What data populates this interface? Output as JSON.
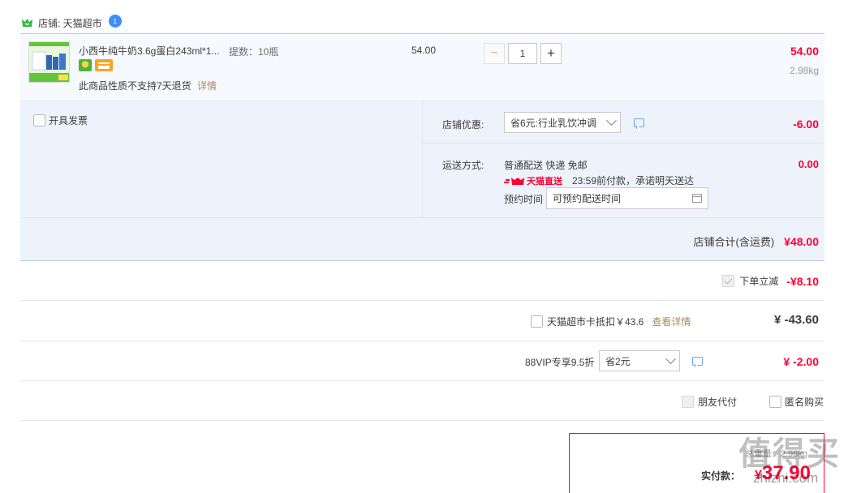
{
  "shop": {
    "label": "店铺: 天猫超市",
    "badge": "1"
  },
  "item": {
    "title": "小西牛纯牛奶3.6g蛋白243ml*1...",
    "spec": "提数：10瓶",
    "unit_price": "54.00",
    "quantity": "1",
    "minus": "−",
    "plus": "+",
    "subtotal": "54.00",
    "weight": "2.98kg",
    "return_note": "此商品性质不支持7天退货",
    "details_link": "详情"
  },
  "invoice": {
    "label": "开具发票"
  },
  "discount": {
    "label": "店铺优惠:",
    "selected": "省6元:行业乳饮冲调",
    "amount": "-6.00"
  },
  "shipping": {
    "label": "运送方式:",
    "method": "普通配送 快递 免邮",
    "brand": "天猫直送",
    "promise": "23:59前付款，承诺明天送达",
    "amount": "0.00",
    "reserve_label": "预约时间",
    "reserve_placeholder": "可预约配送时间"
  },
  "shop_total": {
    "label": "店铺合计(含运费)",
    "amount": "¥48.00"
  },
  "order_discount": {
    "label": "下单立减",
    "amount": "-¥8.10"
  },
  "card": {
    "label": "天猫超市卡抵扣￥43.6",
    "link": "查看详情",
    "amount": "¥ -43.60"
  },
  "vip": {
    "label": "88VIP专享9.5折",
    "selected": "省2元",
    "amount": "¥ -2.00"
  },
  "options": {
    "friend_pay": "朋友代付",
    "anonymous": "匿名购买"
  },
  "summary": {
    "weight_label": "总重量：2.98kg",
    "pay_label": "实付款：",
    "currency": "¥",
    "pay_amount": "37.90"
  },
  "watermark": {
    "logo": "值得买",
    "site": "zhizhi.com"
  },
  "colors": {
    "accent": "#ff0036",
    "panel": "#eef3fb",
    "link": "#b0855c"
  }
}
